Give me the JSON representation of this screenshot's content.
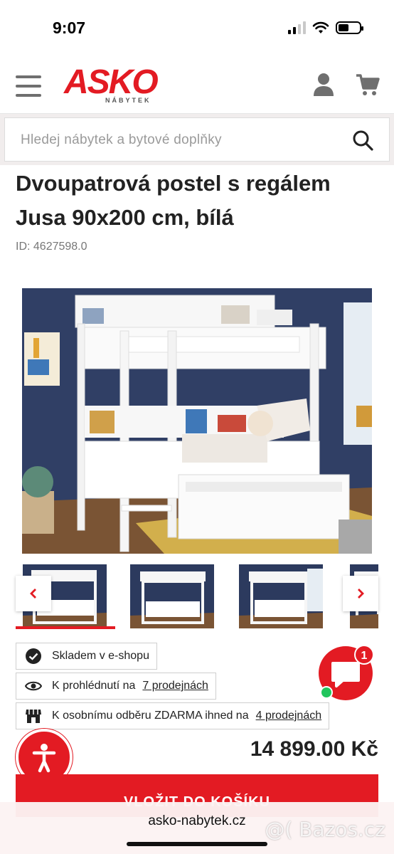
{
  "status_bar": {
    "time": "9:07"
  },
  "header": {
    "logo_text": "ASKO",
    "logo_subtext": "NÁBYTEK",
    "menu_icon": "hamburger-icon",
    "user_icon": "user-icon",
    "cart_icon": "cart-icon"
  },
  "search": {
    "placeholder": "Hledej nábytek a bytové doplňky"
  },
  "product": {
    "title": "Dvoupatrová postel s regálem Jusa 90x200 cm, bílá",
    "id_label": "ID: 4627598.0",
    "price": "14 899.00 Kč"
  },
  "gallery": {
    "thumbnail_count_visible": 4,
    "active_index": 0
  },
  "availability": [
    {
      "icon": "check-circle-icon",
      "text": "Skladem v e-shopu",
      "link": ""
    },
    {
      "icon": "eye-icon",
      "text": "K prohlédnutí na",
      "link": "7 prodejnách"
    },
    {
      "icon": "store-icon",
      "text": "K osobnímu odběru ZDARMA ihned na",
      "link": "4 prodejnách"
    }
  ],
  "chat": {
    "badge_count": "1"
  },
  "add_to_cart": {
    "label": "VLOŽIT DO KOŠÍKU"
  },
  "browser": {
    "url": "asko-nabytek.cz",
    "watermark": "@( Bazos.cz"
  },
  "colors": {
    "brand_red": "#e31b23",
    "wall_blue": "#2c3a5e"
  }
}
